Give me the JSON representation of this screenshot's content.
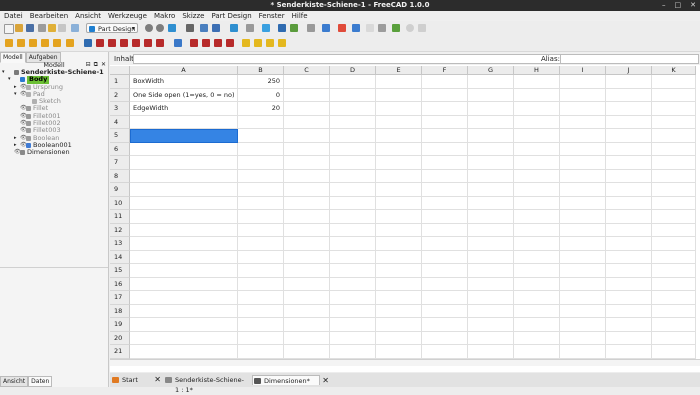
{
  "window": {
    "title": "* Senderkiste-Schiene-1 - FreeCAD 1.0.0",
    "controls": [
      "–",
      "□",
      "✕"
    ]
  },
  "menu": [
    "Datei",
    "Bearbeiten",
    "Ansicht",
    "Werkzeuge",
    "Makro",
    "Skizze",
    "Part Design",
    "Fenster",
    "Hilfe"
  ],
  "toolbar": {
    "workbench": "Part Design"
  },
  "left_panel": {
    "tabs": [
      "Modell",
      "Aufgaben"
    ],
    "header": "Modell",
    "tree": [
      {
        "label": "Senderkiste-Schiene-1",
        "level": 0,
        "arrow": "▾",
        "eye": "",
        "icon": "#7a7a7a",
        "style": "bold"
      },
      {
        "label": "Body",
        "level": 1,
        "arrow": "▾",
        "eye": "",
        "icon": "#2a7ad0",
        "style": "highlight"
      },
      {
        "label": "Ursprung",
        "level": 2,
        "arrow": "▸",
        "eye": "👁",
        "icon": "#b0b0b0",
        "style": "dim"
      },
      {
        "label": "Pad",
        "level": 2,
        "arrow": "▾",
        "eye": "👁",
        "icon": "#b0b0b0",
        "style": "dim"
      },
      {
        "label": "Sketch",
        "level": 3,
        "arrow": "",
        "eye": "",
        "icon": "#b0b0b0",
        "style": "dim"
      },
      {
        "label": "Fillet",
        "level": 2,
        "arrow": "",
        "eye": "👁",
        "icon": "#9a9a9a",
        "style": "dim"
      },
      {
        "label": "Fillet001",
        "level": 2,
        "arrow": "",
        "eye": "👁",
        "icon": "#9a9a9a",
        "style": "dim"
      },
      {
        "label": "Fillet002",
        "level": 2,
        "arrow": "",
        "eye": "👁",
        "icon": "#9a9a9a",
        "style": "dim"
      },
      {
        "label": "Fillet003",
        "level": 2,
        "arrow": "",
        "eye": "👁",
        "icon": "#9a9a9a",
        "style": "dim"
      },
      {
        "label": "Boolean",
        "level": 2,
        "arrow": "▸",
        "eye": "👁",
        "icon": "#9a9a9a",
        "style": "dim"
      },
      {
        "label": "Boolean001",
        "level": 2,
        "arrow": "▸",
        "eye": "👁",
        "icon": "#3f7bd4",
        "style": "normal"
      },
      {
        "label": "Dimensionen",
        "level": 1,
        "arrow": "",
        "eye": "👁",
        "icon": "#8a8a8a",
        "style": "normal"
      }
    ],
    "bottom_tabs": [
      "Ansicht",
      "Daten"
    ]
  },
  "sheet": {
    "inhalt_label": "Inhalt:",
    "alias_label": "Alias:",
    "columns": [
      "A",
      "B",
      "C",
      "D",
      "E",
      "F",
      "G",
      "H",
      "I",
      "J",
      "K"
    ],
    "rows": [
      "1",
      "2",
      "3",
      "4",
      "5",
      "6",
      "7",
      "8",
      "9",
      "10",
      "11",
      "12",
      "13",
      "14",
      "15",
      "16",
      "17",
      "18",
      "19",
      "20",
      "21"
    ],
    "cells": [
      {
        "row": 1,
        "a": "BoxWidth",
        "b": "250"
      },
      {
        "row": 2,
        "a": "One Side open (1=yes, 0 = no)",
        "b": "0"
      },
      {
        "row": 3,
        "a": "EdgeWidth",
        "b": "20"
      }
    ],
    "selected": "A5"
  },
  "doc_tabs": [
    {
      "label": "Start",
      "icon": "#e07a22",
      "active": false
    },
    {
      "label": "Senderkiste-Schiene-1 : 1*",
      "icon": "#888888",
      "active": false
    },
    {
      "label": "Dimensionen*",
      "icon": "#555555",
      "active": true
    }
  ],
  "close_glyph": "✕",
  "colors": {
    "accent": "#3584e4",
    "body_highlight": "#6bbf34"
  }
}
